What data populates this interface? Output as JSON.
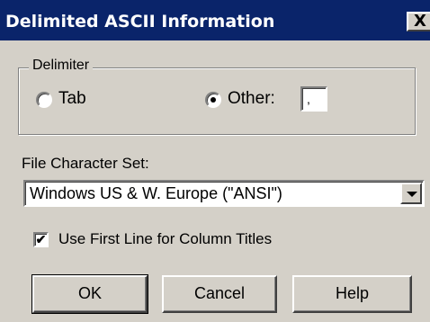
{
  "window": {
    "title": "Delimited ASCII Information",
    "close_glyph": "X"
  },
  "delimiter": {
    "group_label": "Delimiter",
    "tab_label": "Tab",
    "other_label": "Other:",
    "selected": "other",
    "other_value": ","
  },
  "charset": {
    "label": "File Character Set:",
    "selected": "Windows US & W. Europe (\"ANSI\")"
  },
  "options": {
    "first_line_label": "Use First Line for Column Titles",
    "first_line_checked": true,
    "check_glyph": "✔"
  },
  "buttons": {
    "ok": "OK",
    "cancel": "Cancel",
    "help": "Help"
  }
}
